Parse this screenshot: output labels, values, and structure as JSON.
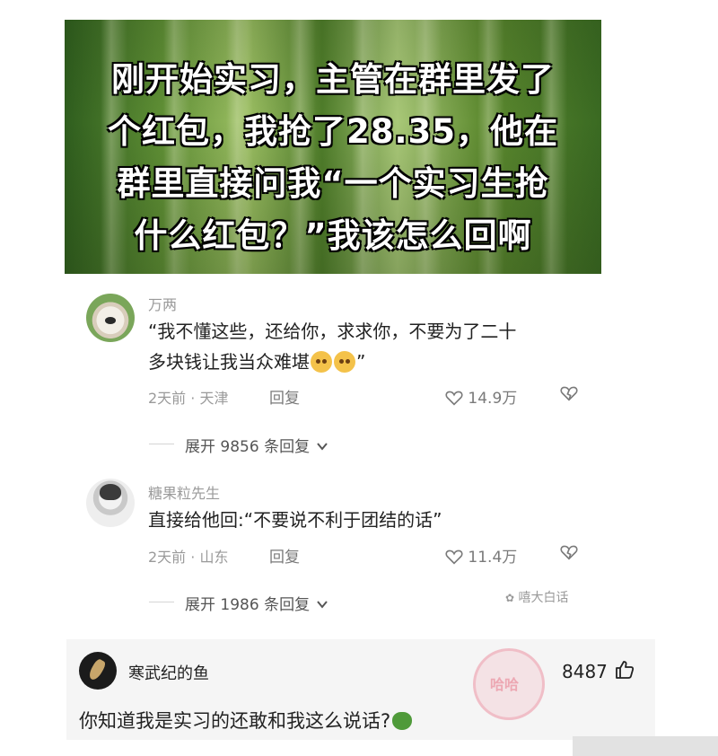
{
  "banner": {
    "lines": [
      "刚开始实习，主管在群里发了",
      "个红包，我抢了28.35，他在",
      "群里直接问我“一个实习生抢",
      "什么红包？”我该怎么回啊"
    ]
  },
  "comments": [
    {
      "username": "万两",
      "text_line1": "“我不懂这些，还给你，求求你，不要为了二十",
      "text_line2": "多块钱让我当众难堪",
      "text_line2_end": "”",
      "meta": "2天前 · 天津",
      "reply_label": "回复",
      "likes": "14.9万",
      "expand_label": "展开 9856 条回复"
    },
    {
      "username": "糖果粒先生",
      "text_line1": "直接给他回:“不要说不利于团结的话”",
      "meta": "2天前 · 山东",
      "reply_label": "回复",
      "likes": "11.4万",
      "expand_label": "展开 1986 条回复"
    }
  ],
  "watermark": "嘻大白话",
  "bottom_comment": {
    "username": "寒武纪的鱼",
    "likes": "8487",
    "text": "你知道我是实习的还敢和我这么说话?"
  },
  "stamp_text": "哈哈"
}
